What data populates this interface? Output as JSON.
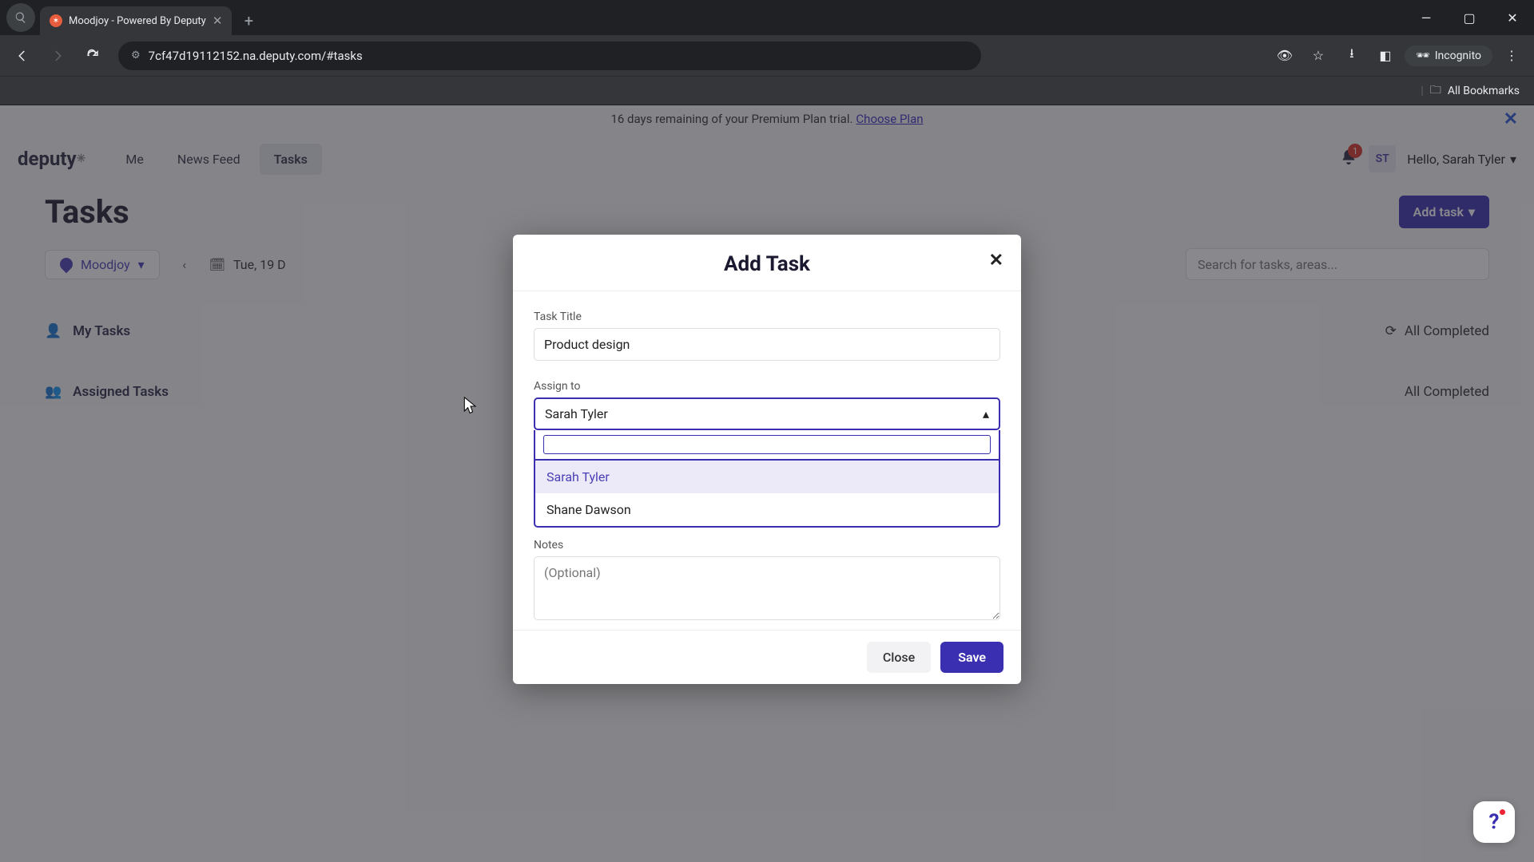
{
  "browser": {
    "tab_title": "Moodjoy - Powered By Deputy",
    "url": "7cf47d19112152.na.deputy.com/#tasks",
    "incognito_label": "Incognito",
    "all_bookmarks": "All Bookmarks"
  },
  "banner": {
    "text": "16 days remaining of your Premium Plan trial.",
    "link": "Choose Plan"
  },
  "header": {
    "logo": "deputy",
    "nav": {
      "me": "Me",
      "news": "News Feed",
      "tasks": "Tasks"
    },
    "notif_count": "1",
    "avatar_initials": "ST",
    "greeting": "Hello, Sarah Tyler"
  },
  "page": {
    "title": "Tasks",
    "add_task_btn": "Add task",
    "location": "Moodjoy",
    "date": "Tue, 19 D",
    "search_placeholder": "Search for tasks, areas...",
    "sections": {
      "my_tasks": {
        "label": "My Tasks",
        "status": "All Completed"
      },
      "assigned": {
        "label": "Assigned Tasks",
        "status": "All Completed"
      }
    }
  },
  "modal": {
    "title": "Add Task",
    "task_title_label": "Task Title",
    "task_title_value": "Product design",
    "assign_label": "Assign to",
    "assign_selected": "Sarah Tyler",
    "assign_options": [
      "Sarah Tyler",
      "Shane Dawson"
    ],
    "notes_label": "Notes",
    "notes_placeholder": "(Optional)",
    "close_btn": "Close",
    "save_btn": "Save"
  }
}
